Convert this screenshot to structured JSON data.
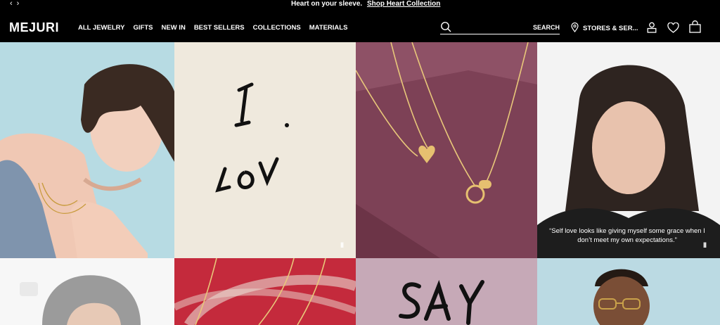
{
  "announcement": {
    "prev_arrow": "‹",
    "next_arrow": "›",
    "message": "Heart on your sleeve.",
    "link": "Shop Heart Collection"
  },
  "header": {
    "logo": "MEJURI",
    "nav_items": [
      "ALL JEWELRY",
      "GIFTS",
      "NEW IN",
      "BEST SELLERS",
      "COLLECTIONS",
      "MATERIALS"
    ],
    "search": {
      "label": "SEARCH",
      "placeholder": "",
      "value": ""
    },
    "stores_label": "STORES & SER..."
  },
  "icons": [
    "search-icon",
    "location-pin-icon",
    "account-icon",
    "wishlist-heart-icon",
    "shopping-bag-icon"
  ],
  "tiles": {
    "handwriting_1": "I Lov.",
    "handwriting_2": "SAY",
    "quote": "“Self love looks like giving myself some grace when I don’t meet my own expectations.”",
    "pause_glyph": "II"
  },
  "colors": {
    "header_bg": "#000000",
    "text": "#ffffff",
    "tile_cream": "#efe9dd",
    "tile_mauve": "#7a3e52",
    "tile_lilac": "#c6a9b7",
    "tile_red": "#c0283b",
    "tile_sky": "#b9d9e3"
  }
}
